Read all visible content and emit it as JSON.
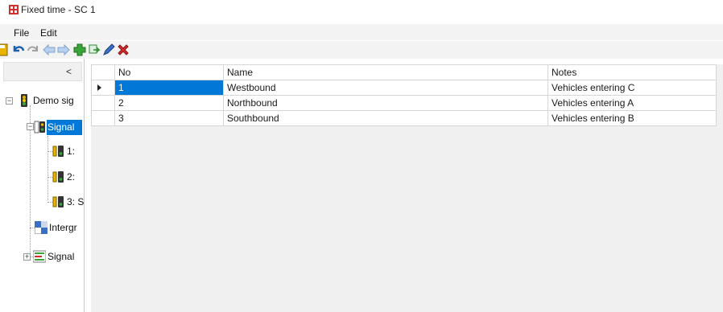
{
  "window": {
    "title": "Fixed time - SC 1"
  },
  "menu": {
    "file": "File",
    "edit": "Edit"
  },
  "toolbar": {
    "icons": [
      "save-icon",
      "undo-icon",
      "redo-icon",
      "back-arrow-icon",
      "forward-arrow-icon",
      "add-icon",
      "duplicate-icon",
      "edit-pencil-icon",
      "delete-icon"
    ]
  },
  "sidebar": {
    "collapse_label": "<",
    "tree": {
      "root": "Demo sig",
      "signal_group": "Signal",
      "children": [
        "1:",
        "2:",
        "3: S"
      ],
      "intergreen": "Intergr",
      "signal_plans": "Signal"
    }
  },
  "grid": {
    "columns": [
      "No",
      "Name",
      "Notes"
    ],
    "rows": [
      {
        "no": "1",
        "name": "Westbound",
        "notes": "Vehicles entering C"
      },
      {
        "no": "2",
        "name": "Northbound",
        "notes": "Vehicles entering A"
      },
      {
        "no": "3",
        "name": "Southbound",
        "notes": "Vehicles entering B"
      }
    ],
    "selected_row": 0
  },
  "colors": {
    "accent": "#0078d7",
    "grid_bg": "#f0f0f0"
  }
}
